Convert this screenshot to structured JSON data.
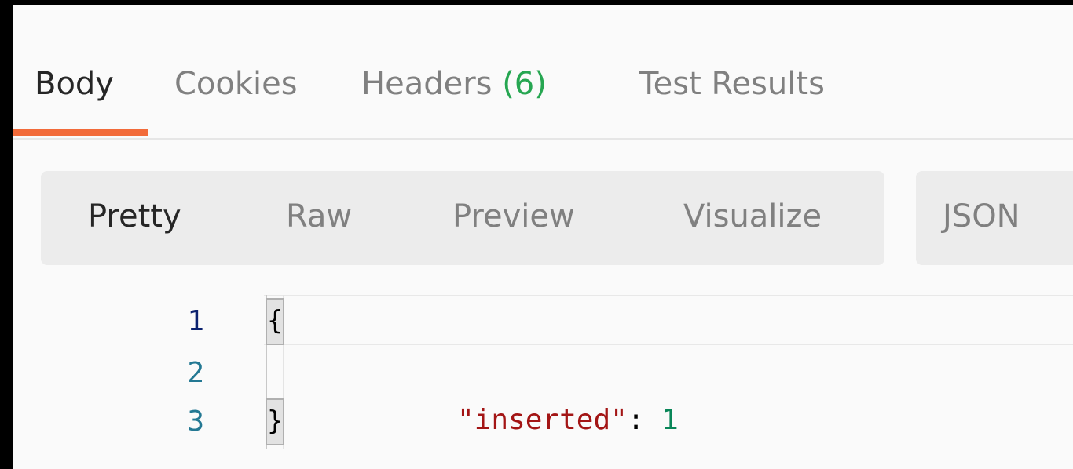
{
  "response_tabs": {
    "body": "Body",
    "cookies": "Cookies",
    "headers": "Headers",
    "headers_count": "(6)",
    "test_results": "Test Results"
  },
  "format_buttons": {
    "pretty": "Pretty",
    "raw": "Raw",
    "preview": "Preview",
    "visualize": "Visualize"
  },
  "language_select": {
    "value": "JSON"
  },
  "editor": {
    "line_numbers": [
      "1",
      "2",
      "3"
    ],
    "open_brace": "{",
    "close_brace": "}",
    "key": "\"inserted\"",
    "separator": ": ",
    "value": "1"
  },
  "colors": {
    "active_tab_underline": "#f26b3a",
    "headers_count": "#26a651",
    "json_key": "#a31515",
    "json_number": "#098658"
  }
}
